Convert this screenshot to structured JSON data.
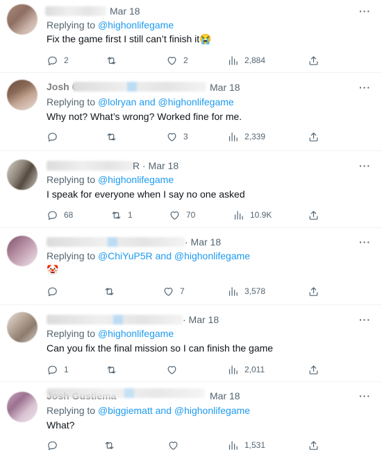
{
  "icons": {
    "reply": "reply-bubble-icon",
    "retweet": "retweet-icon",
    "like": "heart-icon",
    "views": "analytics-bars-icon",
    "share": "share-upload-icon",
    "more": "more-horizontal-icon"
  },
  "colors": {
    "link": "#1d9bf0",
    "muted": "#536471",
    "text": "#0f1419"
  },
  "tweets": [
    {
      "date": "Mar 18",
      "replying_prefix": "Replying to ",
      "replying_to": "@highonlifegame",
      "text": "Fix the game first I still can’t finish it",
      "emoji": "😭",
      "stats": {
        "replies": "2",
        "retweets": "",
        "likes": "2",
        "views": "2,884"
      }
    },
    {
      "name_fragment": "Josh C",
      "date": "Mar 18",
      "replying_prefix": "Replying to ",
      "replying_to": "@lolryan and @highonlifegame",
      "text": "Why not? What’s wrong? Worked fine for me.",
      "stats": {
        "replies": "",
        "retweets": "",
        "likes": "3",
        "views": "2,339"
      }
    },
    {
      "date": "R · Mar 18",
      "replying_prefix": "Replying to ",
      "replying_to": "@highonlifegame",
      "text": "I speak for everyone when I say no one asked",
      "stats": {
        "replies": "68",
        "retweets": "1",
        "likes": "70",
        "views": "10.9K"
      }
    },
    {
      "date": "· Mar 18",
      "replying_prefix": "Replying to ",
      "replying_to": "@ChiYuP5R and @highonlifegame",
      "text": "",
      "emoji": "🤡",
      "stats": {
        "replies": "",
        "retweets": "",
        "likes": "7",
        "views": "3,578"
      }
    },
    {
      "date": "· Mar 18",
      "replying_prefix": "Replying to ",
      "replying_to": "@highonlifegame",
      "text": "Can you fix the final mission so I can finish the game",
      "stats": {
        "replies": "1",
        "retweets": "",
        "likes": "",
        "views": "2,011"
      }
    },
    {
      "name_fragment": "Josh Gustiema",
      "date": "Mar 18",
      "replying_prefix": "Replying to ",
      "replying_to": "@biggiematt and @highonlifegame",
      "text": "What?",
      "stats": {
        "replies": "",
        "retweets": "",
        "likes": "",
        "views": "1,531"
      }
    }
  ],
  "more_label": "···"
}
